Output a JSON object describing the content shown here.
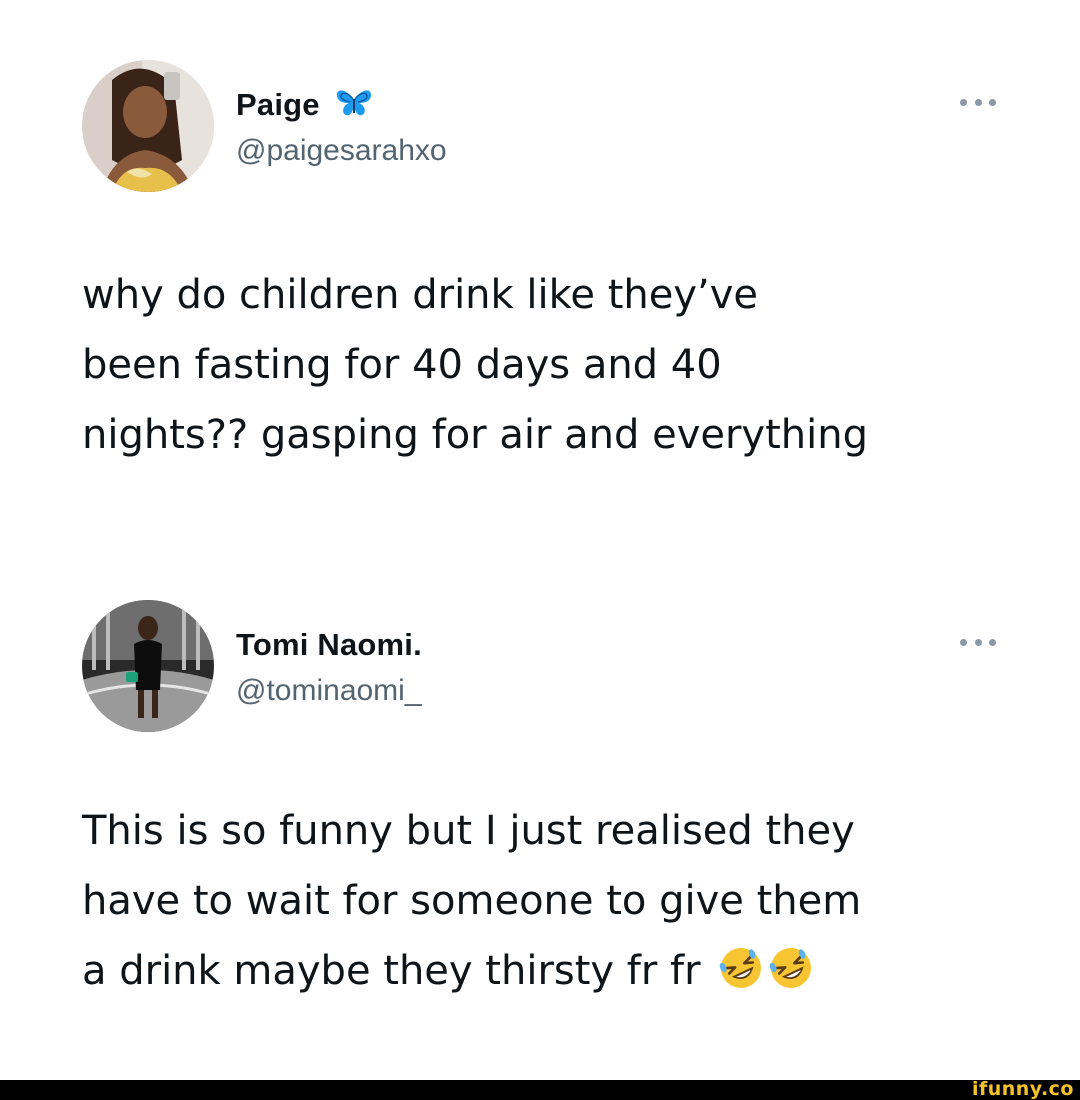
{
  "tweets": [
    {
      "display_name": "Paige",
      "name_icon": "butterfly-icon",
      "handle": "@paigesarahxo",
      "more_icon": "ellipsis-icon",
      "text_lines": [
        "why do children drink like they’ve",
        "been fasting for 40 days and 40",
        "nights?? gasping for air and everything"
      ]
    },
    {
      "display_name": "Tomi Naomi.",
      "handle": "@tominaomi_",
      "more_icon": "ellipsis-icon",
      "text_lines": [
        "This is so funny but I just realised they",
        "have to wait for someone to give them",
        "a drink maybe they thirsty fr fr"
      ],
      "trailing_emojis": [
        "rolling-on-floor-laughing-emoji",
        "rolling-on-floor-laughing-emoji"
      ]
    }
  ],
  "watermark": {
    "text": "ifunny.co",
    "color": "#f3c327"
  },
  "colors": {
    "text": "#0f1419",
    "handle": "#536471",
    "butterfly": "#1d9bf0"
  }
}
